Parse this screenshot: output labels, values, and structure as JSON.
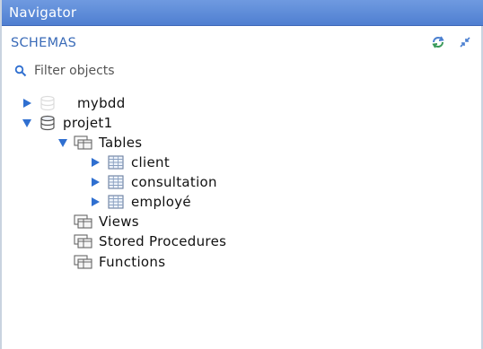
{
  "navigator": {
    "title": "Navigator",
    "schemas_label": "SCHEMAS",
    "filter_placeholder": "Filter objects"
  },
  "tree": {
    "mybdd": "mybdd",
    "projet1": "projet1",
    "tables": "Tables",
    "client": "client",
    "consultation": "consultation",
    "employe": "employé",
    "views": "Views",
    "stored_procedures": "Stored Procedures",
    "functions": "Functions"
  },
  "colors": {
    "titlebar": "#5b88d6",
    "schemas_label": "#3a6bb8",
    "arrow": "#2f6fd0"
  },
  "icons": {
    "header_left": "refresh-icon",
    "header_right": "collapse-icon",
    "filter": "search-icon",
    "database": "database-icon",
    "folder": "folder-icon",
    "table": "table-icon"
  }
}
